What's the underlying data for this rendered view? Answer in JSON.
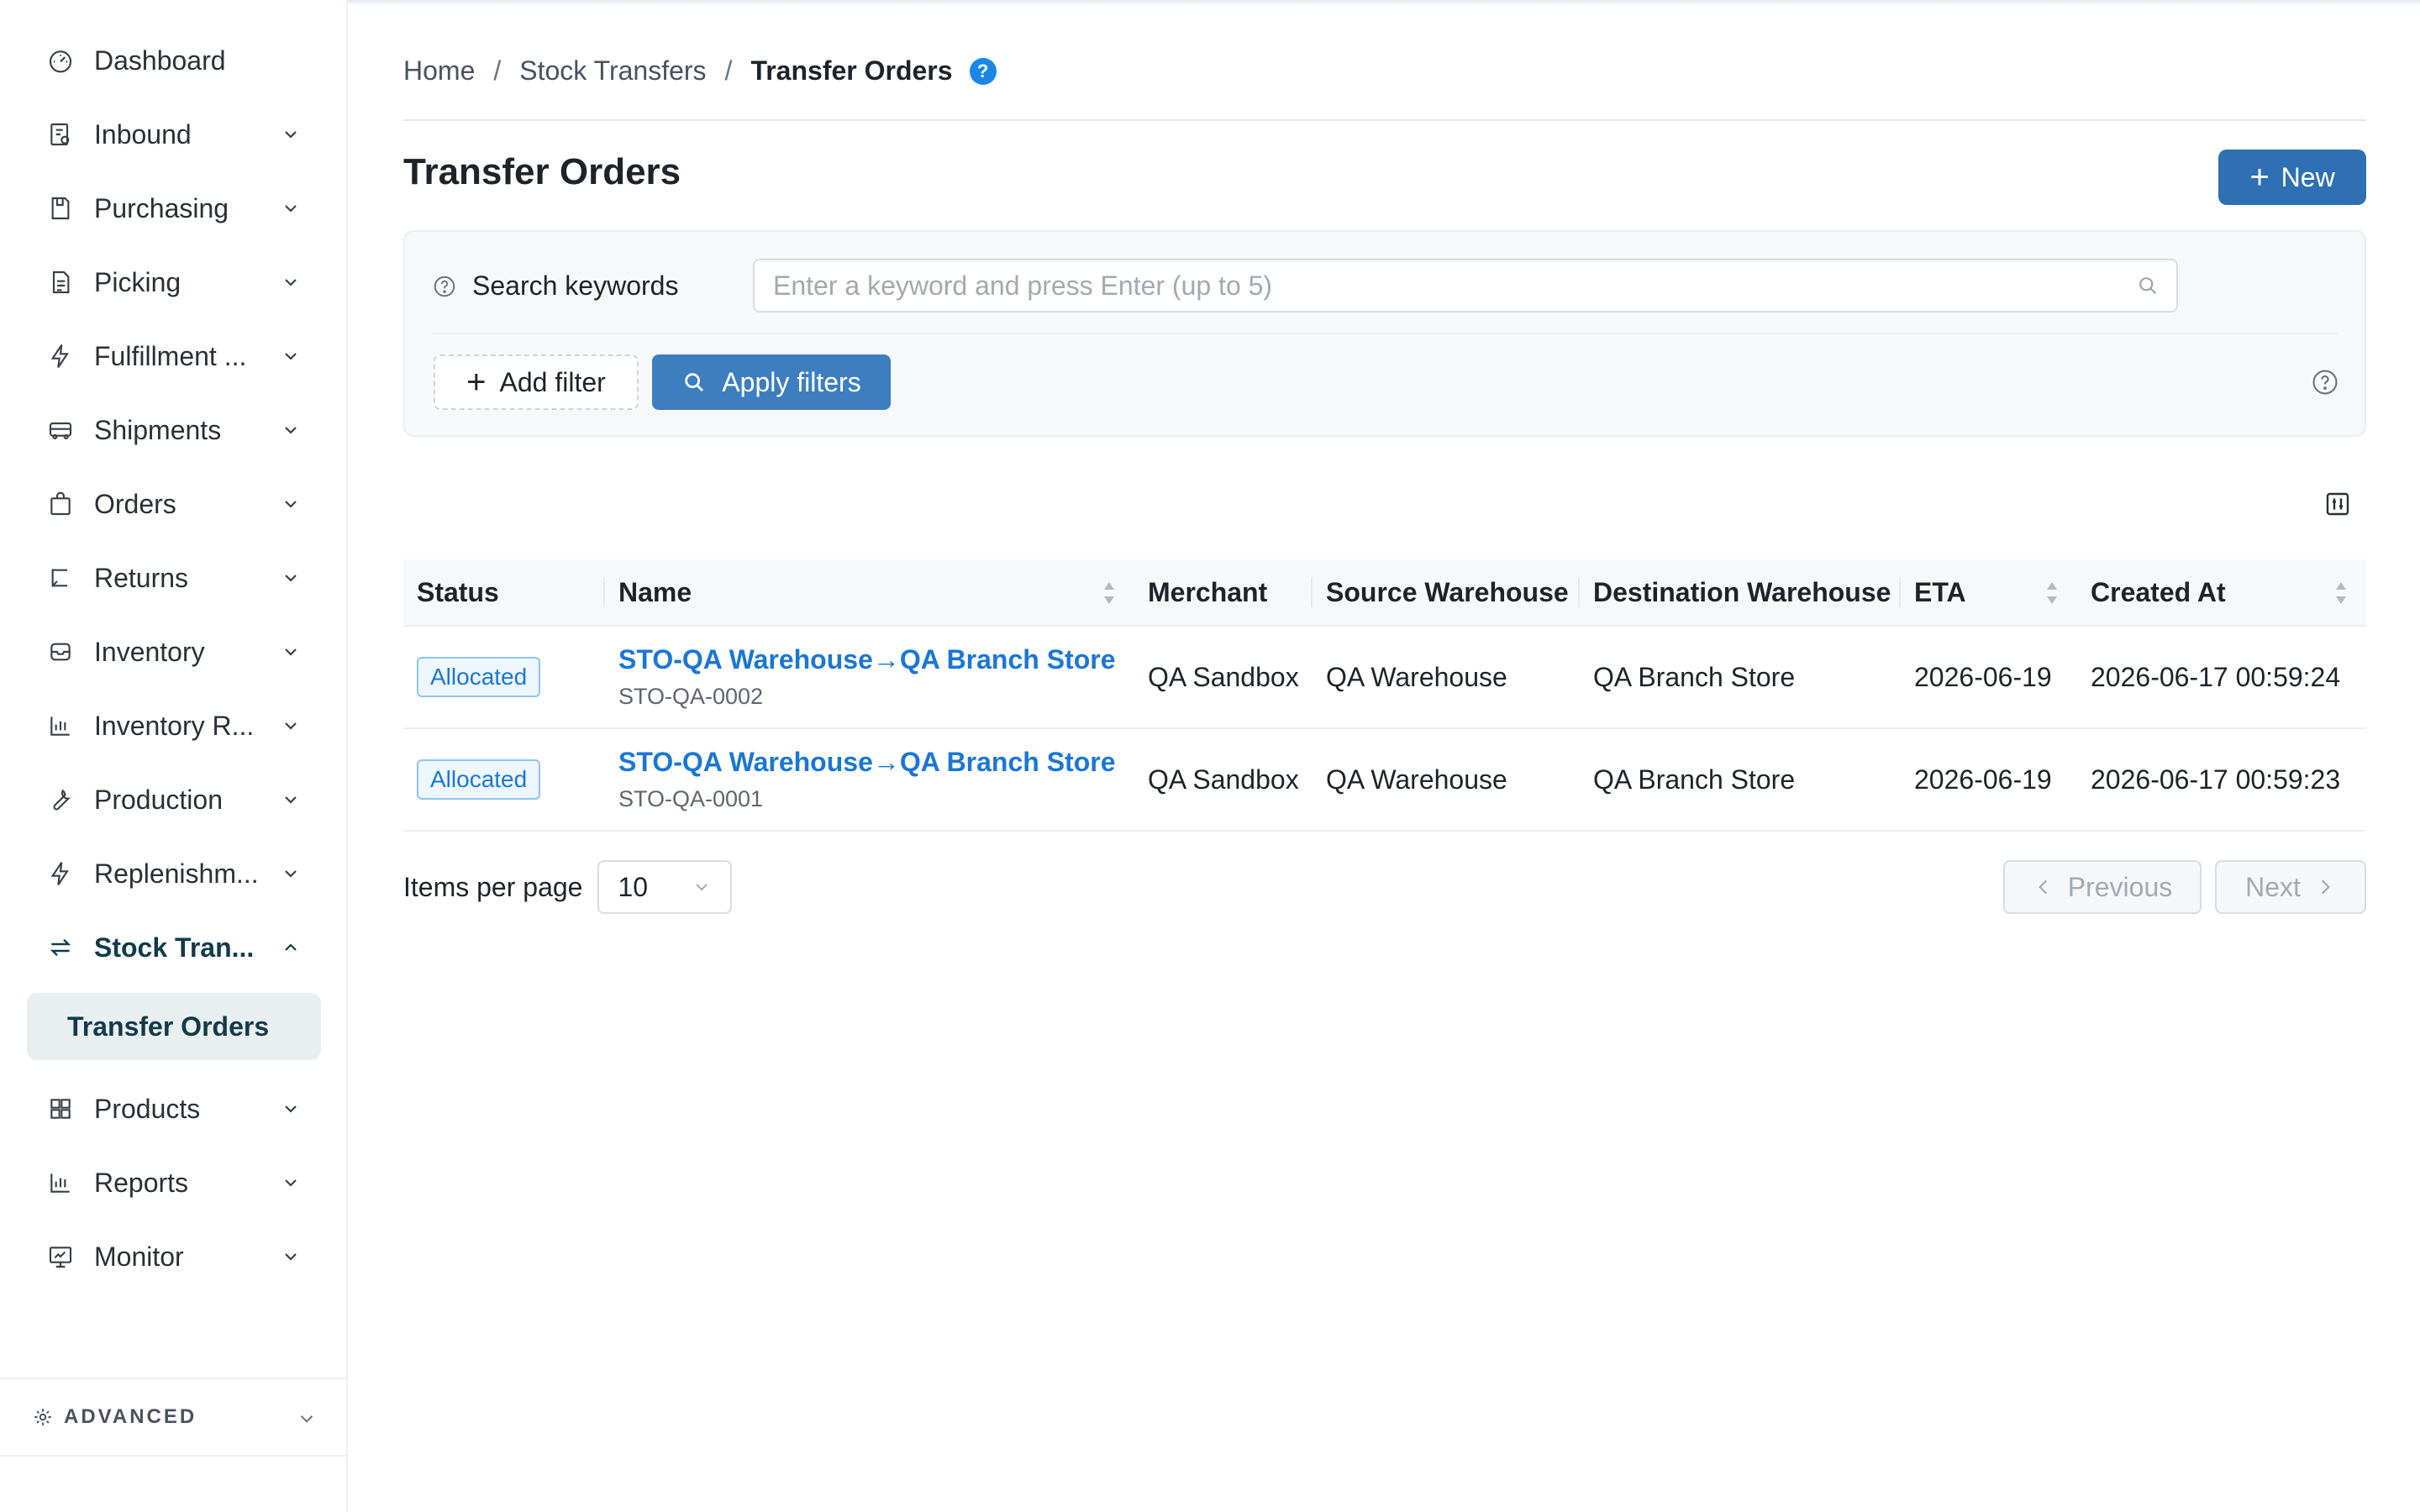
{
  "sidebar": {
    "items": [
      {
        "label": "Dashboard",
        "icon": "dashboard-icon",
        "has_chevron": false
      },
      {
        "label": "Inbound",
        "icon": "inbound-icon",
        "has_chevron": true
      },
      {
        "label": "Purchasing",
        "icon": "purchasing-icon",
        "has_chevron": true
      },
      {
        "label": "Picking",
        "icon": "picking-icon",
        "has_chevron": true
      },
      {
        "label": "Fulfillment ...",
        "icon": "bolt-icon",
        "has_chevron": true
      },
      {
        "label": "Shipments",
        "icon": "truck-icon",
        "has_chevron": true
      },
      {
        "label": "Orders",
        "icon": "bag-icon",
        "has_chevron": true
      },
      {
        "label": "Returns",
        "icon": "return-icon",
        "has_chevron": true
      },
      {
        "label": "Inventory",
        "icon": "inbox-icon",
        "has_chevron": true
      },
      {
        "label": "Inventory R...",
        "icon": "bar-chart-icon",
        "has_chevron": true
      },
      {
        "label": "Production",
        "icon": "wrench-icon",
        "has_chevron": true
      },
      {
        "label": "Replenishm...",
        "icon": "bolt-icon",
        "has_chevron": true
      },
      {
        "label": "Stock Tran...",
        "icon": "swap-icon",
        "has_chevron": true,
        "expanded": true
      },
      {
        "label": "Products",
        "icon": "grid-icon",
        "has_chevron": true
      },
      {
        "label": "Reports",
        "icon": "bar-chart-icon",
        "has_chevron": true
      },
      {
        "label": "Monitor",
        "icon": "monitor-icon",
        "has_chevron": true
      }
    ],
    "subitem_active": "Transfer Orders",
    "advanced_label": "ADVANCED"
  },
  "breadcrumb": {
    "items": [
      "Home",
      "Stock Transfers",
      "Transfer Orders"
    ],
    "help": "?"
  },
  "page": {
    "title": "Transfer Orders",
    "new_button": "New"
  },
  "filters": {
    "search_label": "Search keywords",
    "search_placeholder": "Enter a keyword and press Enter (up to 5)",
    "add_filter": "Add filter",
    "apply_filters": "Apply filters"
  },
  "table": {
    "columns": [
      "Status",
      "Name",
      "Merchant",
      "Source Warehouse",
      "Destination Warehouse",
      "ETA",
      "Created At"
    ],
    "rows": [
      {
        "status": "Allocated",
        "name": "STO-QA Warehouse→QA Branch Store",
        "code": "STO-QA-0002",
        "merchant": "QA Sandbox",
        "source": "QA Warehouse",
        "destination": "QA Branch Store",
        "eta": "2026-06-19",
        "created_at": "2026-06-17 00:59:24"
      },
      {
        "status": "Allocated",
        "name": "STO-QA Warehouse→QA Branch Store",
        "code": "STO-QA-0001",
        "merchant": "QA Sandbox",
        "source": "QA Warehouse",
        "destination": "QA Branch Store",
        "eta": "2026-06-19",
        "created_at": "2026-06-17 00:59:23"
      }
    ]
  },
  "pagination": {
    "items_per_page_label": "Items per page",
    "items_per_page_value": "10",
    "previous": "Previous",
    "next": "Next"
  },
  "colors": {
    "primary": "#2f6fb3",
    "link": "#1a77d4",
    "active_nav_bg": "#e9eef1"
  }
}
